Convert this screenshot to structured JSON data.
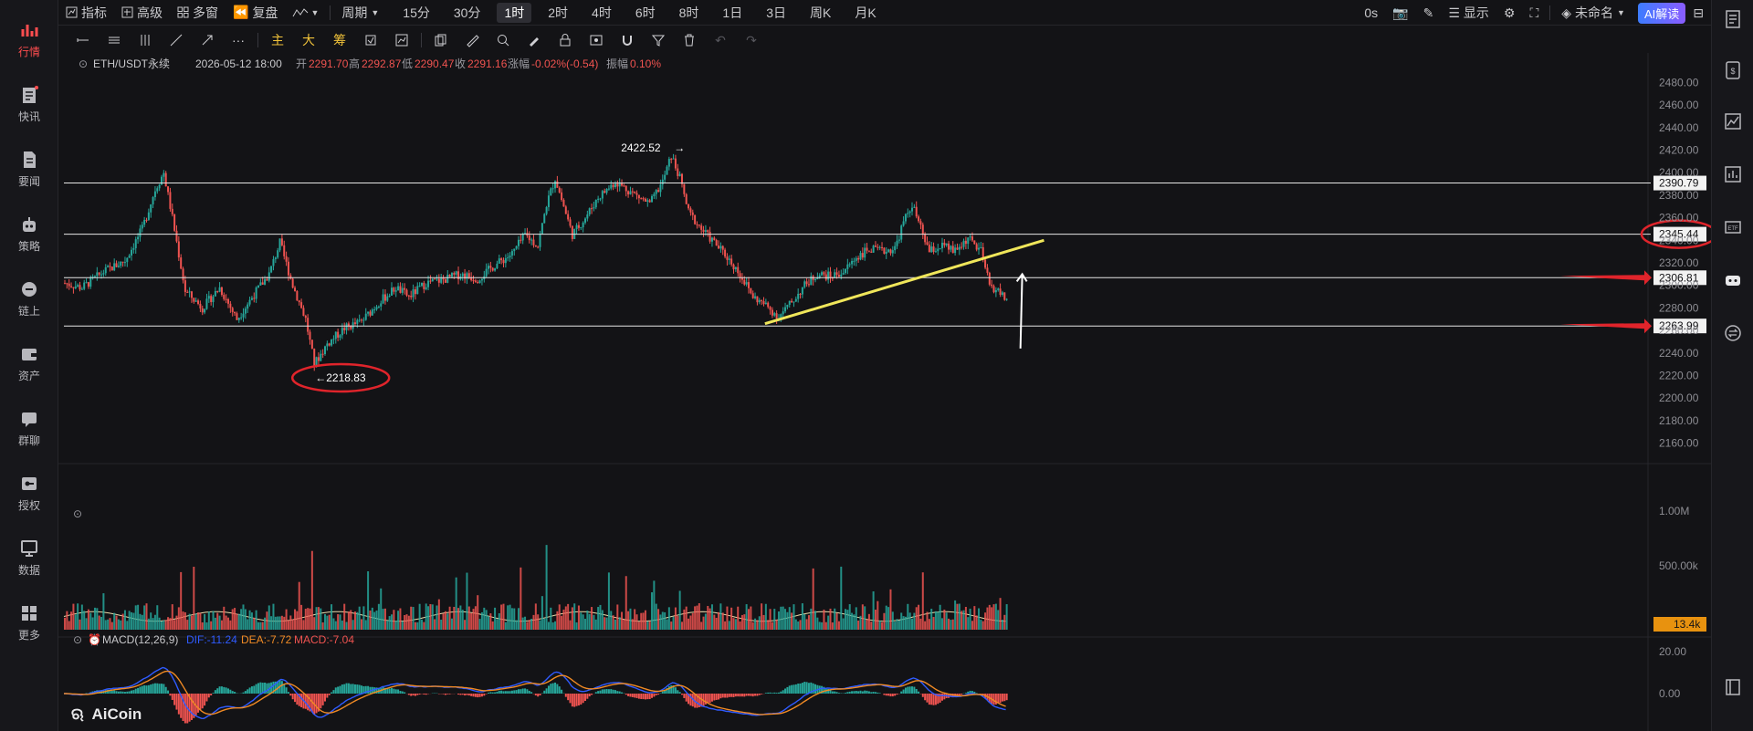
{
  "nav": [
    {
      "label": "行情",
      "icon": "chart-bars-icon",
      "active": true
    },
    {
      "label": "快讯",
      "icon": "flash-news-icon"
    },
    {
      "label": "要闻",
      "icon": "document-icon"
    },
    {
      "label": "策略",
      "icon": "robot-icon"
    },
    {
      "label": "链上",
      "icon": "chain-icon"
    },
    {
      "label": "资产",
      "icon": "wallet-icon"
    },
    {
      "label": "群聊",
      "icon": "chat-icon"
    },
    {
      "label": "授权",
      "icon": "key-icon"
    },
    {
      "label": "数据",
      "icon": "monitor-icon"
    },
    {
      "label": "更多",
      "icon": "grid-icon"
    }
  ],
  "toolbar": {
    "indicators": "指标",
    "advanced": "高级",
    "multi_window": "多窗",
    "replay": "复盘",
    "period": "周期",
    "intervals": [
      "15分",
      "30分",
      "1时",
      "2时",
      "4时",
      "6时",
      "8时",
      "1日",
      "3日",
      "周K",
      "月K"
    ],
    "active_interval": "1时",
    "countdown": "0s",
    "display": "显示",
    "layout_name": "未命名",
    "ai_button": "AI解读"
  },
  "drawbar": {
    "text_tools": [
      "主",
      "大",
      "筹"
    ]
  },
  "info": {
    "symbol": "ETH/USDT永续",
    "datetime": "2026-05-12 18:00",
    "open_label": "开",
    "open": "2291.70",
    "high_label": "高",
    "high": "2292.87",
    "low_label": "低",
    "low": "2290.47",
    "close_label": "收",
    "close": "2291.16",
    "change_label": "涨幅",
    "change": "-0.02%(-0.54)",
    "amp_label": "振幅",
    "amp": "0.10%"
  },
  "macd": {
    "label": "MACD(12,26,9)",
    "dif": "DIF:-11.24",
    "dea": "DEA:-7.72",
    "macd": "MACD:-7.04"
  },
  "logo": "AiCoin",
  "colors": {
    "up": "#26a69a",
    "down": "#ef5350",
    "accent": "#f0c23a",
    "annotation": "#e0242b",
    "dif": "#2f5bff",
    "dea": "#f08a24"
  },
  "chart_data": {
    "type": "candlestick",
    "price_axis": {
      "ticks": [
        "2480.00",
        "2460.00",
        "2440.00",
        "2420.00",
        "2400.00",
        "2380.00",
        "2360.00",
        "2340.00",
        "2320.00",
        "2300.00",
        "2280.00",
        "2260.00",
        "2240.00",
        "2220.00",
        "2200.00",
        "2180.00",
        "2160.00"
      ],
      "range": [
        2150,
        2490
      ]
    },
    "volume_axis": {
      "ticks": [
        "1.00M",
        "500.00k"
      ],
      "current": "13.4k"
    },
    "macd_axis": {
      "ticks": [
        "20.00",
        "0.00"
      ]
    },
    "price_path": [
      {
        "i": 0,
        "p": 2302
      },
      {
        "i": 8,
        "p": 2298
      },
      {
        "i": 18,
        "p": 2312
      },
      {
        "i": 28,
        "p": 2322
      },
      {
        "i": 36,
        "p": 2350
      },
      {
        "i": 42,
        "p": 2385
      },
      {
        "i": 46,
        "p": 2400
      },
      {
        "i": 50,
        "p": 2360
      },
      {
        "i": 56,
        "p": 2295
      },
      {
        "i": 64,
        "p": 2280
      },
      {
        "i": 72,
        "p": 2298
      },
      {
        "i": 80,
        "p": 2270
      },
      {
        "i": 88,
        "p": 2292
      },
      {
        "i": 95,
        "p": 2310
      },
      {
        "i": 100,
        "p": 2338
      },
      {
        "i": 106,
        "p": 2300
      },
      {
        "i": 112,
        "p": 2270
      },
      {
        "i": 116,
        "p": 2230
      },
      {
        "i": 122,
        "p": 2248
      },
      {
        "i": 130,
        "p": 2262
      },
      {
        "i": 138,
        "p": 2268
      },
      {
        "i": 146,
        "p": 2285
      },
      {
        "i": 154,
        "p": 2298
      },
      {
        "i": 160,
        "p": 2290
      },
      {
        "i": 168,
        "p": 2302
      },
      {
        "i": 176,
        "p": 2305
      },
      {
        "i": 184,
        "p": 2310
      },
      {
        "i": 192,
        "p": 2306
      },
      {
        "i": 200,
        "p": 2318
      },
      {
        "i": 208,
        "p": 2328
      },
      {
        "i": 214,
        "p": 2345
      },
      {
        "i": 220,
        "p": 2335
      },
      {
        "i": 224,
        "p": 2372
      },
      {
        "i": 228,
        "p": 2395
      },
      {
        "i": 232,
        "p": 2370
      },
      {
        "i": 236,
        "p": 2345
      },
      {
        "i": 242,
        "p": 2360
      },
      {
        "i": 248,
        "p": 2378
      },
      {
        "i": 256,
        "p": 2392
      },
      {
        "i": 264,
        "p": 2382
      },
      {
        "i": 272,
        "p": 2372
      },
      {
        "i": 278,
        "p": 2392
      },
      {
        "i": 282,
        "p": 2415
      },
      {
        "i": 286,
        "p": 2395
      },
      {
        "i": 290,
        "p": 2365
      },
      {
        "i": 296,
        "p": 2350
      },
      {
        "i": 302,
        "p": 2338
      },
      {
        "i": 308,
        "p": 2325
      },
      {
        "i": 314,
        "p": 2310
      },
      {
        "i": 320,
        "p": 2290
      },
      {
        "i": 326,
        "p": 2282
      },
      {
        "i": 332,
        "p": 2272
      },
      {
        "i": 338,
        "p": 2285
      },
      {
        "i": 344,
        "p": 2300
      },
      {
        "i": 350,
        "p": 2310
      },
      {
        "i": 356,
        "p": 2308
      },
      {
        "i": 362,
        "p": 2312
      },
      {
        "i": 368,
        "p": 2325
      },
      {
        "i": 374,
        "p": 2332
      },
      {
        "i": 380,
        "p": 2330
      },
      {
        "i": 386,
        "p": 2333
      },
      {
        "i": 390,
        "p": 2356
      },
      {
        "i": 394,
        "p": 2372
      },
      {
        "i": 398,
        "p": 2350
      },
      {
        "i": 402,
        "p": 2330
      },
      {
        "i": 408,
        "p": 2335
      },
      {
        "i": 414,
        "p": 2330
      },
      {
        "i": 420,
        "p": 2342
      },
      {
        "i": 426,
        "p": 2330
      },
      {
        "i": 430,
        "p": 2300
      },
      {
        "i": 434,
        "p": 2295
      },
      {
        "i": 438,
        "p": 2287
      }
    ],
    "high_label": "2422.52",
    "low_label": "2218.83",
    "horizontal_levels": [
      "2390.79",
      "2345.44",
      "2306.81",
      "2263.99"
    ],
    "trendline": {
      "from_price": 2266,
      "to_price": 2340,
      "color": "#f0e65a"
    },
    "arrow_up_note": "white upward arrow",
    "circled_levels": [
      "2218.83",
      "2345.44"
    ]
  }
}
